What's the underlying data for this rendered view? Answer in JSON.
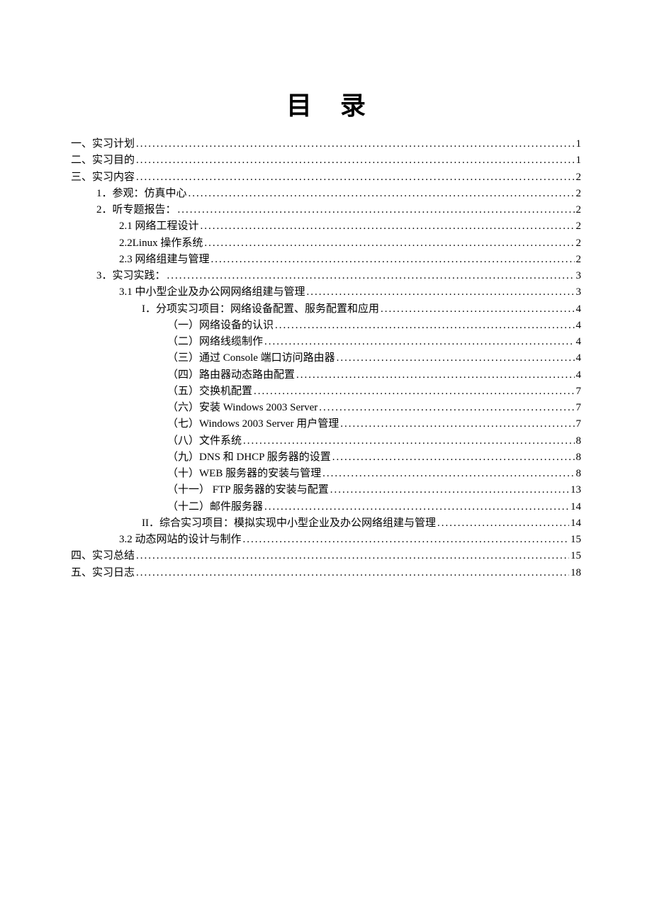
{
  "title": "目录",
  "entries": [
    {
      "level": 0,
      "label": "一、实习计划",
      "page": "1"
    },
    {
      "level": 0,
      "label": "二、实习目的",
      "page": "1"
    },
    {
      "level": 0,
      "label": "三、实习内容",
      "page": "2"
    },
    {
      "level": 1,
      "label": "1．参观：仿真中心",
      "page": "2"
    },
    {
      "level": 1,
      "label": "2．听专题报告：",
      "page": "2"
    },
    {
      "level": 2,
      "label": "2.1 网络工程设计",
      "page": "2"
    },
    {
      "level": 2,
      "label": "2.2Linux 操作系统",
      "page": "2"
    },
    {
      "level": 2,
      "label": "2.3 网络组建与管理",
      "page": "2"
    },
    {
      "level": 1,
      "label": "3．实习实践：",
      "page": "3"
    },
    {
      "level": 2,
      "label": "3.1 中小型企业及办公网网络组建与管理",
      "page": "3"
    },
    {
      "level": 3,
      "label": "I．分项实习项目：网络设备配置、服务配置和应用",
      "page": "4"
    },
    {
      "level": 4,
      "label": "（一）网络设备的认识",
      "page": "4"
    },
    {
      "level": 4,
      "label": "（二）网络线缆制作",
      "page": "4"
    },
    {
      "level": 4,
      "label": "（三）通过 Console 端口访问路由器",
      "page": "4"
    },
    {
      "level": 4,
      "label": "（四）路由器动态路由配置",
      "page": "4"
    },
    {
      "level": 4,
      "label": "（五）交换机配置",
      "page": "7"
    },
    {
      "level": 4,
      "label": "（六）安装 Windows 2003 Server",
      "page": "7"
    },
    {
      "level": 4,
      "label": "（七）Windows 2003 Server 用户管理",
      "page": "7"
    },
    {
      "level": 4,
      "label": "（八）文件系统",
      "page": "8"
    },
    {
      "level": 4,
      "label": "（九）DNS 和 DHCP 服务器的设置",
      "page": "8"
    },
    {
      "level": 4,
      "label": "（十）WEB 服务器的安装与管理",
      "page": "8"
    },
    {
      "level": 4,
      "label": "（十一）  FTP 服务器的安装与配置",
      "page": "13"
    },
    {
      "level": 4,
      "label": "（十二）邮件服务器",
      "page": "14"
    },
    {
      "level": 3,
      "label": "II．综合实习项目：模拟实现中小型企业及办公网络组建与管理",
      "page": "14"
    },
    {
      "level": 2,
      "label": "3.2 动态网站的设计与制作",
      "page": "15"
    },
    {
      "level": 0,
      "label": "四、实习总结",
      "page": "15"
    },
    {
      "level": 0,
      "label": "五、实习日志",
      "page": "18"
    }
  ]
}
